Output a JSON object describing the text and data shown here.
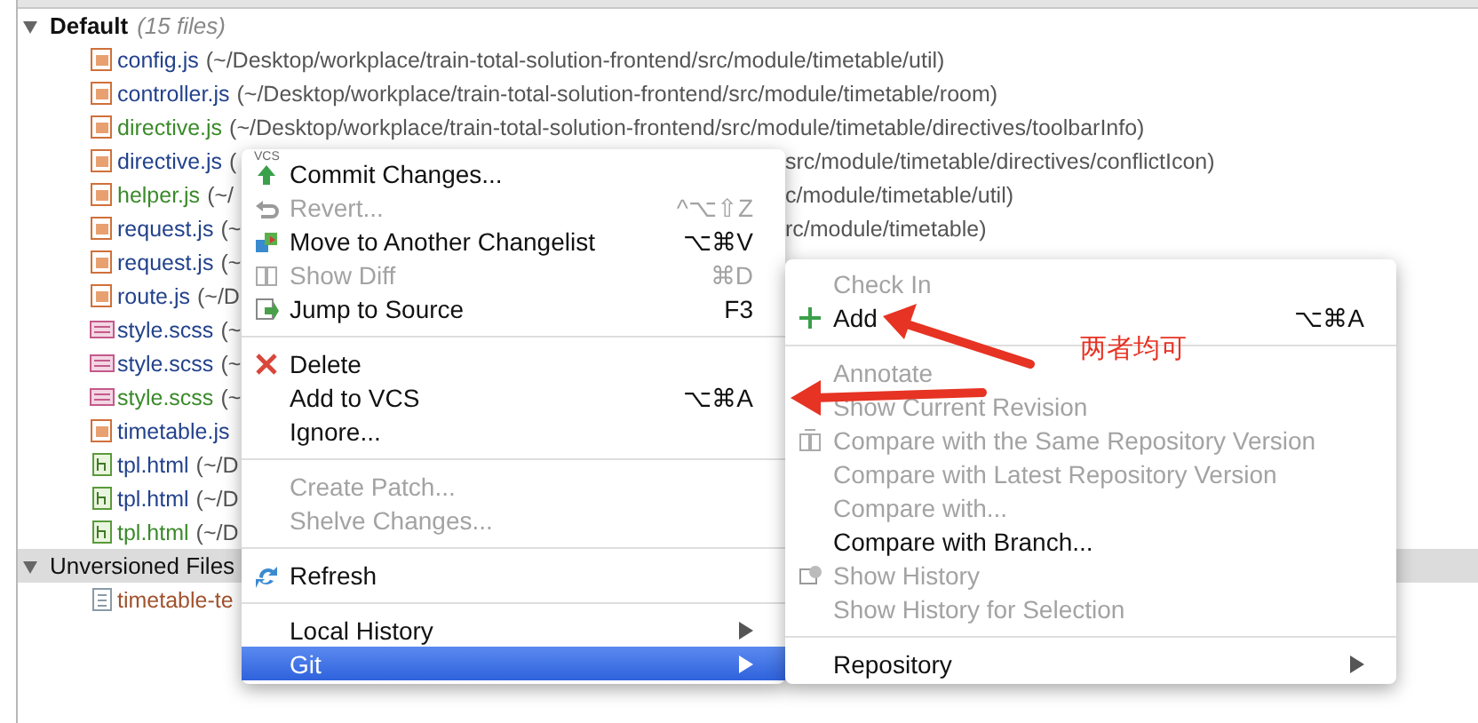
{
  "tree": {
    "groups": [
      {
        "title": "Default",
        "count": "(15 files)",
        "expanded": true,
        "files": [
          {
            "name": "config.js",
            "kind": "js",
            "color": "#23428c",
            "path": "(~/Desktop/workplace/train-total-solution-frontend/src/module/timetable/util)"
          },
          {
            "name": "controller.js",
            "kind": "js",
            "color": "#23428c",
            "path": "(~/Desktop/workplace/train-total-solution-frontend/src/module/timetable/room)"
          },
          {
            "name": "directive.js",
            "kind": "js",
            "color": "#3a8a2a",
            "path": "(~/Desktop/workplace/train-total-solution-frontend/src/module/timetable/directives/toolbarInfo)"
          },
          {
            "name": "directive.js",
            "kind": "js",
            "color": "#23428c",
            "path": "(",
            "path_tail": "src/module/timetable/directives/conflictIcon)"
          },
          {
            "name": "helper.js",
            "kind": "js",
            "color": "#3a8a2a",
            "path": "(~/",
            "path_tail": "c/module/timetable/util)"
          },
          {
            "name": "request.js",
            "kind": "js",
            "color": "#23428c",
            "path": "(~",
            "path_tail": "rc/module/timetable)"
          },
          {
            "name": "request.js",
            "kind": "js",
            "color": "#23428c",
            "path": "(~"
          },
          {
            "name": "route.js",
            "kind": "js",
            "color": "#23428c",
            "path": "(~/D"
          },
          {
            "name": "style.scss",
            "kind": "sass",
            "color": "#23428c",
            "path": "(~"
          },
          {
            "name": "style.scss",
            "kind": "sass",
            "color": "#23428c",
            "path": "(~"
          },
          {
            "name": "style.scss",
            "kind": "sass",
            "color": "#3a8a2a",
            "path": "(~"
          },
          {
            "name": "timetable.js",
            "kind": "js",
            "color": "#23428c"
          },
          {
            "name": "tpl.html",
            "kind": "html",
            "color": "#23428c",
            "path": "(~/D"
          },
          {
            "name": "tpl.html",
            "kind": "html",
            "color": "#23428c",
            "path": "(~/D"
          },
          {
            "name": "tpl.html",
            "kind": "html",
            "color": "#3a8a2a",
            "path": "(~/D"
          }
        ]
      },
      {
        "title": "Unversioned Files",
        "expanded": true,
        "files": [
          {
            "name": "timetable-te",
            "kind": "text",
            "color": "#a0522d"
          }
        ]
      }
    ]
  },
  "context_menu": {
    "items": [
      {
        "kind": "commit",
        "icon_label": "VCS",
        "label": "Commit Changes...",
        "disabled": false
      },
      {
        "kind": "revert",
        "label": "Revert...",
        "shortcut": "^⌥⇧Z",
        "disabled": true
      },
      {
        "kind": "move",
        "label": "Move to Another Changelist",
        "shortcut": "⌥⌘V",
        "disabled": false
      },
      {
        "kind": "diff",
        "label": "Show Diff",
        "shortcut": "⌘D",
        "disabled": true
      },
      {
        "kind": "jump",
        "label": "Jump to Source",
        "shortcut": "F3",
        "disabled": false
      },
      {
        "kind": "separator"
      },
      {
        "kind": "delete",
        "label": "Delete",
        "disabled": false
      },
      {
        "kind": "plain",
        "label": "Add to VCS",
        "shortcut": "⌥⌘A",
        "disabled": false
      },
      {
        "kind": "plain",
        "label": "Ignore...",
        "disabled": false
      },
      {
        "kind": "separator"
      },
      {
        "kind": "plain",
        "label": "Create Patch...",
        "disabled": true
      },
      {
        "kind": "plain",
        "label": "Shelve Changes...",
        "disabled": true
      },
      {
        "kind": "separator"
      },
      {
        "kind": "refresh",
        "label": "Refresh",
        "disabled": false
      },
      {
        "kind": "separator"
      },
      {
        "kind": "plain",
        "label": "Local History",
        "submenu": true,
        "selected": false,
        "disabled": false
      },
      {
        "kind": "plain",
        "label": "Git",
        "submenu": true,
        "selected": true,
        "disabled": false
      }
    ]
  },
  "git_submenu": {
    "items": [
      {
        "kind": "plain",
        "label": "Check In",
        "disabled": true
      },
      {
        "kind": "add",
        "label": "Add",
        "shortcut": "⌥⌘A",
        "disabled": false
      },
      {
        "kind": "separator"
      },
      {
        "kind": "plain",
        "label": "Annotate",
        "disabled": true
      },
      {
        "kind": "plain",
        "label": "Show Current Revision",
        "disabled": true
      },
      {
        "kind": "compare",
        "label": "Compare with the Same Repository Version",
        "disabled": true
      },
      {
        "kind": "plain",
        "label": "Compare with Latest Repository Version",
        "disabled": true
      },
      {
        "kind": "plain",
        "label": "Compare with...",
        "disabled": true
      },
      {
        "kind": "plain",
        "label": "Compare with Branch...",
        "disabled": false
      },
      {
        "kind": "history",
        "label": "Show History",
        "disabled": true
      },
      {
        "kind": "plain",
        "label": "Show History for Selection",
        "disabled": true
      },
      {
        "kind": "separator"
      },
      {
        "kind": "plain",
        "label": "Repository",
        "submenu": true,
        "selected": false,
        "disabled": false
      }
    ]
  },
  "annotation": {
    "note": "两者均可"
  }
}
